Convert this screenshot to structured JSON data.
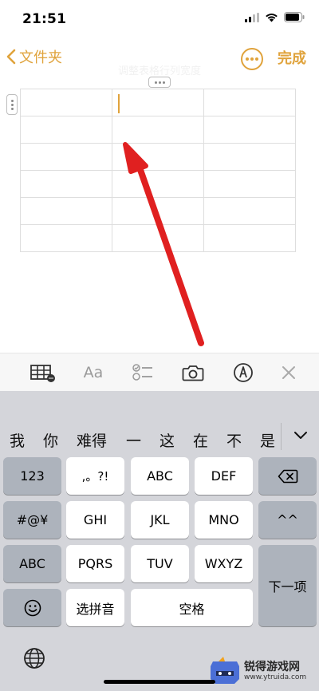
{
  "status": {
    "time": "21:51"
  },
  "nav": {
    "back_label": "文件夹",
    "done_label": "完成"
  },
  "note": {
    "faint_title": "调整表格行列宽度"
  },
  "table": {
    "rows": 6,
    "cols": 3
  },
  "toolbar": {
    "icons": [
      "table-icon",
      "text-format-icon",
      "checklist-icon",
      "camera-icon",
      "markup-icon",
      "close-icon"
    ],
    "format_label": "Aa"
  },
  "keyboard": {
    "candidates": [
      "我",
      "你",
      "难得",
      "一",
      "这",
      "在",
      "不",
      "是"
    ],
    "keys": {
      "num": "123",
      "punct": ",。?!",
      "abc": "ABC",
      "def": "DEF",
      "symbols": "#@¥",
      "ghi": "GHI",
      "jkl": "JKL",
      "mno": "MNO",
      "caret": "^^",
      "abc_switch": "ABC",
      "pqrs": "PQRS",
      "tuv": "TUV",
      "wxyz": "WXYZ",
      "pinyin": "选拼音",
      "space": "空格",
      "next": "下一项"
    }
  },
  "watermark": {
    "name": "锐得游戏网",
    "url": "www.ytruida.com"
  },
  "colors": {
    "accent": "#E0A33C",
    "arrow": "#E02020",
    "keyboard_bg": "#D4D5DA"
  }
}
